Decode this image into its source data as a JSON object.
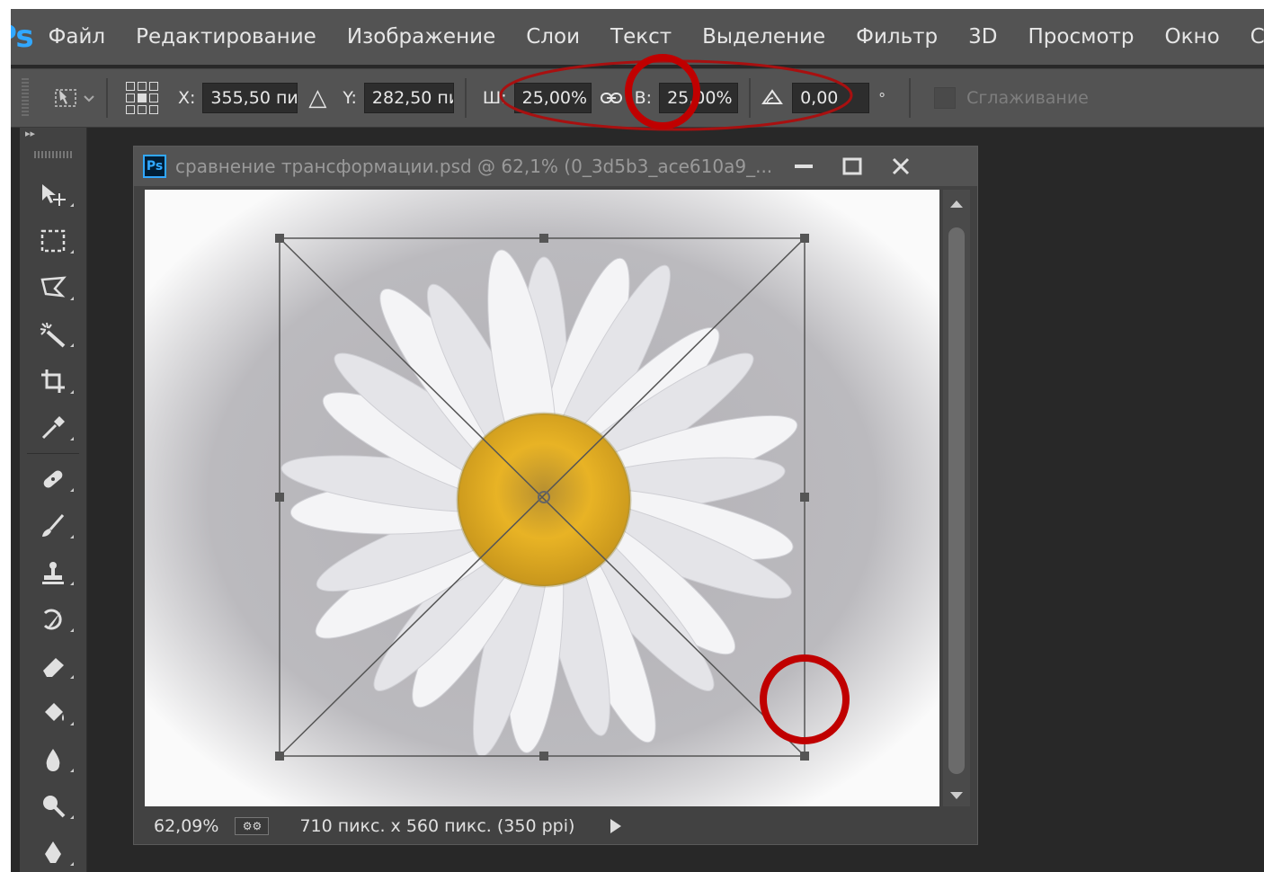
{
  "app": {
    "logo": "Ps",
    "menu": [
      "Файл",
      "Редактирование",
      "Изображение",
      "Слои",
      "Текст",
      "Выделение",
      "Фильтр",
      "3D",
      "Просмотр",
      "Окно",
      "Спр"
    ]
  },
  "options_bar": {
    "x_label": "X:",
    "x_value": "355,50 пи",
    "y_label": "Y:",
    "y_value": "282,50 пи",
    "w_label": "Ш:",
    "w_value": "25,00%",
    "h_label": "В:",
    "h_value": "25,00%",
    "angle_value": "0,00",
    "degree_symbol": "°",
    "antialias_label": "Сглаживание"
  },
  "toolbar": {
    "collapse": "▸▸",
    "tools": [
      "move-tool",
      "marquee-tool",
      "lasso-tool",
      "magic-wand-tool",
      "crop-tool",
      "eyedropper-tool",
      "healing-brush-tool",
      "brush-tool",
      "clone-stamp-tool",
      "history-brush-tool",
      "eraser-tool",
      "paint-bucket-tool",
      "blur-tool",
      "dodge-tool",
      "pen-tool"
    ]
  },
  "document": {
    "icon": "Ps",
    "title": "сравнение трансформации.psd @ 62,1% (0_3d5b3_ace610a9_...",
    "zoom": "62,09%",
    "info": "710 пикс. x 560 пикс. (350 ppi)"
  },
  "colors": {
    "accent": "#31a8ff",
    "annotation": "#c00000",
    "annotation_ellipse": "#a81010"
  }
}
